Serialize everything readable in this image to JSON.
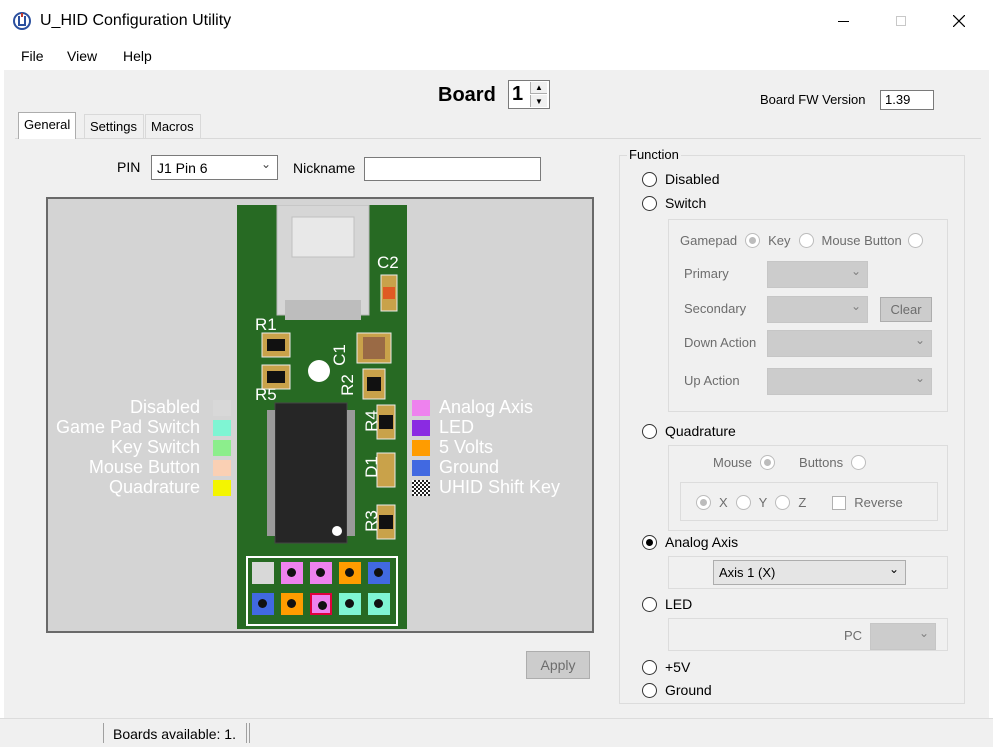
{
  "window": {
    "title": "U_HID Configuration Utility"
  },
  "menu": [
    "File",
    "View",
    "Help"
  ],
  "board": {
    "label": "Board",
    "value": "1"
  },
  "fw": {
    "label": "Board FW Version",
    "value": "1.39"
  },
  "tabs": [
    "General",
    "Settings",
    "Macros"
  ],
  "pin": {
    "label": "PIN",
    "value": "J1 Pin 6",
    "nickname_label": "Nickname",
    "nickname_value": ""
  },
  "board_image": {
    "silkscreen": {
      "c2": "C2",
      "r1": "R1",
      "c1": "C1",
      "r2": "R2",
      "r5": "R5",
      "r4": "R4",
      "d1": "D1",
      "r3": "R3"
    },
    "legend_left": [
      {
        "label": "Disabled",
        "color": "#d8d8d8"
      },
      {
        "label": "Game Pad Switch",
        "color": "#7ff5d3"
      },
      {
        "label": "Key Switch",
        "color": "#8cee8c"
      },
      {
        "label": "Mouse Button",
        "color": "#fad0b4"
      },
      {
        "label": "Quadrature",
        "color": "#f4f500"
      }
    ],
    "legend_right": [
      {
        "label": "Analog Axis",
        "color": "#ee82ee"
      },
      {
        "label": "LED",
        "color": "#8a2be2"
      },
      {
        "label": "5 Volts",
        "color": "#ff9c00"
      },
      {
        "label": "Ground",
        "color": "#4169e1"
      },
      {
        "label": "UHID Shift Key",
        "color": "checker"
      }
    ],
    "pins_top": [
      "#d8d8d8",
      "#ee82ee",
      "#ee82ee",
      "#ff9c00",
      "#4169e1"
    ],
    "pins_bottom": [
      "#4169e1",
      "#ff9c00",
      "#ee82ee",
      "#7ff5d3",
      "#7ff5d3"
    ]
  },
  "apply_label": "Apply",
  "function": {
    "title": "Function",
    "disabled": "Disabled",
    "switch": "Switch",
    "switch_group": {
      "gamepad": "Gamepad",
      "key": "Key",
      "mouse_button": "Mouse Button",
      "primary": "Primary",
      "secondary": "Secondary",
      "clear": "Clear",
      "down_action": "Down Action",
      "up_action": "Up Action"
    },
    "quadrature": "Quadrature",
    "quadrature_group": {
      "mouse": "Mouse",
      "buttons": "Buttons",
      "x": "X",
      "y": "Y",
      "z": "Z",
      "reverse": "Reverse"
    },
    "analog_axis": "Analog Axis",
    "analog_axis_value": "Axis 1 (X)",
    "led": "LED",
    "led_group": {
      "pc": "PC"
    },
    "plus5v": "+5V",
    "ground": "Ground",
    "selected": "analog_axis"
  },
  "status": {
    "boards_available": "Boards available: 1."
  }
}
